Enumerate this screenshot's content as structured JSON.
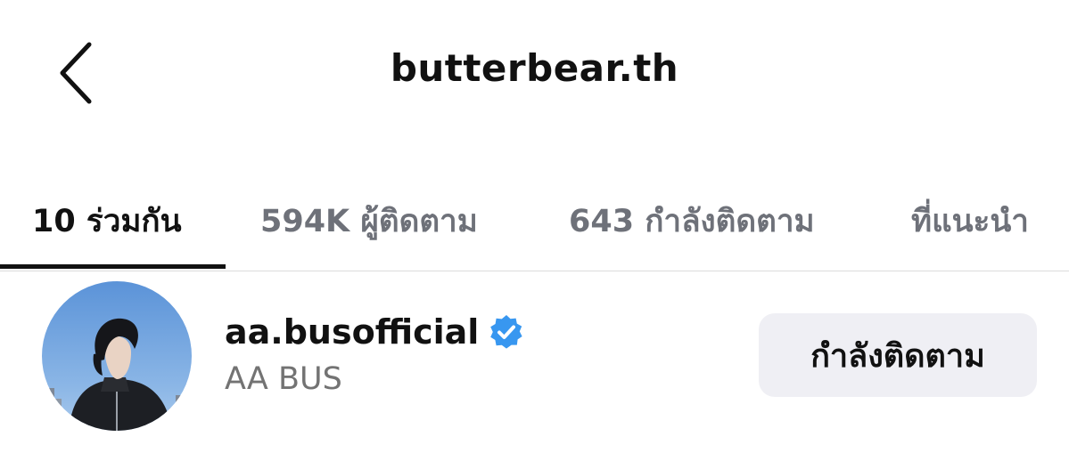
{
  "header": {
    "title": "butterbear.th",
    "back_icon": "chevron-left-icon"
  },
  "tabs": [
    {
      "label": "10 ร่วมกัน",
      "active": true
    },
    {
      "label": "594K ผู้ติดตาม",
      "active": false
    },
    {
      "label": "643 กำลังติดตาม",
      "active": false
    },
    {
      "label": "ที่แนะนำ",
      "active": false
    }
  ],
  "accounts": [
    {
      "username": "aa.busofficial",
      "full_name": "AA BUS",
      "verified": true,
      "verified_icon": "verified-badge-icon",
      "button_label": "กำลังติดตาม"
    }
  ],
  "colors": {
    "verified_blue": "#3897f0",
    "button_bg": "#efeff4",
    "tab_inactive": "#6e7179",
    "text_primary": "#111111",
    "text_secondary": "#737373"
  }
}
